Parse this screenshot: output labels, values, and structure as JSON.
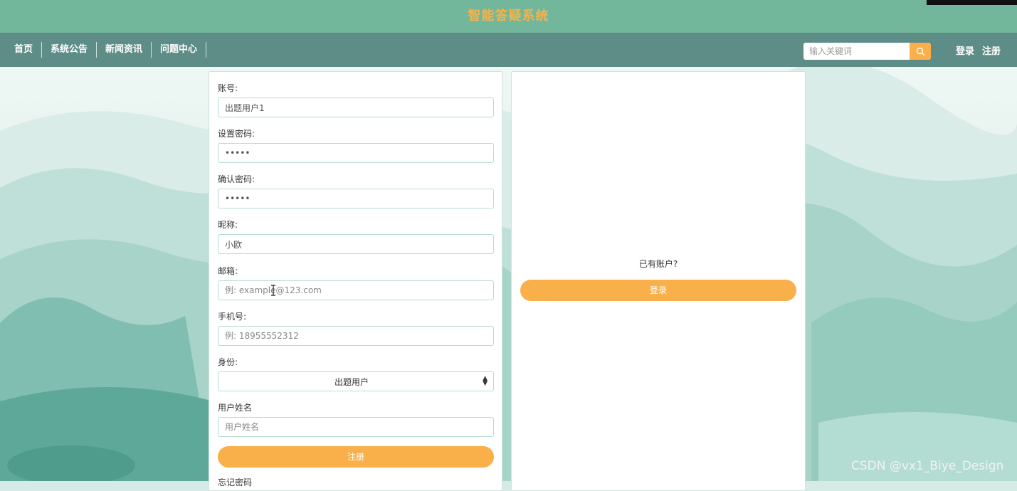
{
  "header": {
    "title": "智能答疑系统"
  },
  "nav": {
    "items": [
      {
        "label": "首页"
      },
      {
        "label": "系统公告"
      },
      {
        "label": "新闻资讯"
      },
      {
        "label": "问题中心"
      }
    ],
    "search": {
      "placeholder": "输入关键词",
      "icon": "search-icon"
    },
    "auth": {
      "login": "登录",
      "register": "注册"
    }
  },
  "register_form": {
    "account": {
      "label": "账号:",
      "value": "出题用户1"
    },
    "password": {
      "label": "设置密码:",
      "value": "•••••"
    },
    "confirm_password": {
      "label": "确认密码:",
      "value": "•••••"
    },
    "nickname": {
      "label": "昵称:",
      "value": "小欧"
    },
    "email": {
      "label": "邮箱:",
      "placeholder": "例: example@123.com"
    },
    "phone": {
      "label": "手机号:",
      "placeholder": "例: 18955552312"
    },
    "role": {
      "label": "身份:",
      "selected": "出题用户",
      "icon": "select-arrows-icon"
    },
    "username": {
      "label": "用户姓名",
      "placeholder": "用户姓名"
    },
    "submit_label": "注册",
    "forgot_label": "忘记密码"
  },
  "login_panel": {
    "prompt": "已有账户?",
    "login_label": "登录"
  },
  "watermark": "CSDN @vx1_Biye_Design",
  "colors": {
    "title_bar": "#72b79b",
    "nav_bar": "#5e8d88",
    "accent": "#f9b04a",
    "title_text": "#f6b24a"
  }
}
